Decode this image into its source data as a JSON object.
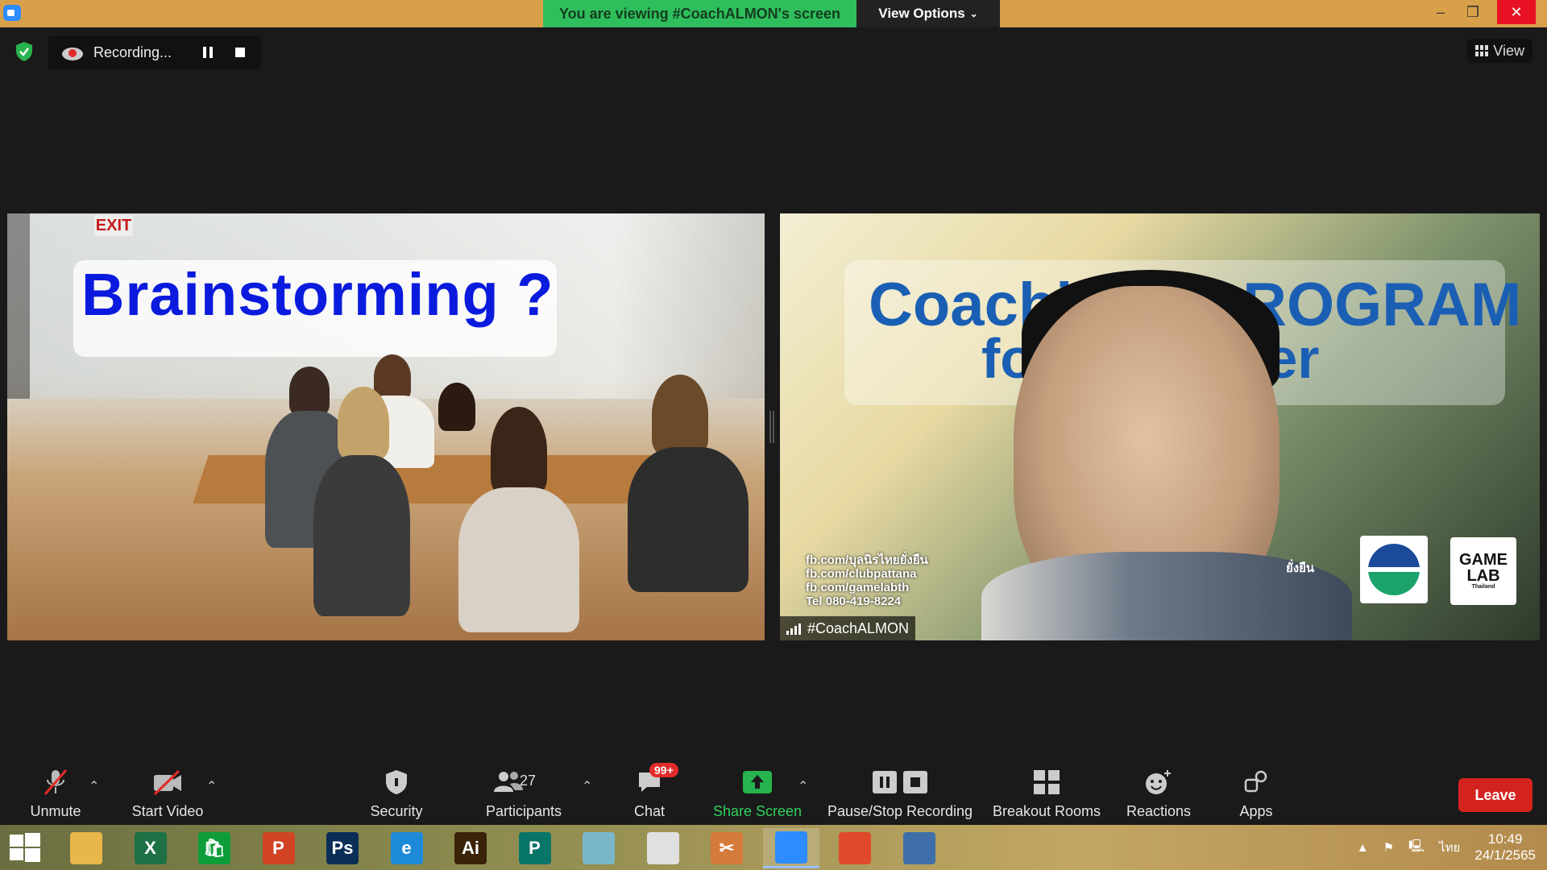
{
  "title_bar": {
    "banner_text": "You are viewing #CoachALMON's screen",
    "view_options_label": "View Options",
    "minimize": "–",
    "restore": "❐",
    "close": "✕"
  },
  "top_bar": {
    "recording_label": "Recording...",
    "view_label": "View"
  },
  "share": {
    "left_slide_title": "Brainstorming ?",
    "exit_sign": "EXIT",
    "right_title_line1": "Coachi",
    "right_title_line1b": "PROGRAM",
    "right_title_line2": "fo",
    "right_title_line2b": "rer",
    "contacts": [
      "fb.com/บุลนิรไทยยั่งยืน",
      "fb.com/clubpattana",
      "fb.com/gamelabth",
      "Tel 080-419-8224"
    ],
    "thai_snippet": "ยั่งยืน",
    "logo2_line1": "GAME",
    "logo2_line2": "LAB",
    "logo2_line3": "Thailand",
    "presenter_name": "#CoachALMON"
  },
  "toolbar": {
    "unmute": "Unmute",
    "start_video": "Start Video",
    "security": "Security",
    "participants": "Participants",
    "participants_count": "27",
    "chat": "Chat",
    "chat_badge": "99+",
    "share_screen": "Share Screen",
    "pause_stop_recording": "Pause/Stop Recording",
    "breakout_rooms": "Breakout Rooms",
    "reactions": "Reactions",
    "apps": "Apps",
    "leave": "Leave"
  },
  "taskbar": {
    "apps": [
      {
        "name": "File Explorer",
        "glyph": "",
        "color": "#e8b64a"
      },
      {
        "name": "Excel",
        "glyph": "X",
        "color": "#1e7145"
      },
      {
        "name": "Store",
        "glyph": "🛍",
        "color": "#0f9d3a"
      },
      {
        "name": "PowerPoint",
        "glyph": "P",
        "color": "#d04423"
      },
      {
        "name": "Photoshop",
        "glyph": "Ps",
        "color": "#0b2e56"
      },
      {
        "name": "Internet Explorer",
        "glyph": "e",
        "color": "#1d8ad8"
      },
      {
        "name": "Illustrator",
        "glyph": "Ai",
        "color": "#3a2308"
      },
      {
        "name": "Publisher",
        "glyph": "P",
        "color": "#077568"
      },
      {
        "name": "Paint",
        "glyph": "",
        "color": "#7ab7c9"
      },
      {
        "name": "Chrome",
        "glyph": "",
        "color": "#e0e0e0"
      },
      {
        "name": "Snip",
        "glyph": "✂",
        "color": "#d47a3a"
      },
      {
        "name": "Zoom",
        "glyph": "",
        "color": "#2d8cff"
      },
      {
        "name": "Presentation",
        "glyph": "",
        "color": "#e04a2a"
      },
      {
        "name": "Control Panel",
        "glyph": "",
        "color": "#3f6fa8"
      }
    ],
    "language": "ไทย",
    "time": "10:49",
    "date": "24/1/2565"
  },
  "colors": {
    "share_banner": "#2fbe5c",
    "leave": "#d4231f",
    "share_screen_label": "#2fd15c"
  }
}
